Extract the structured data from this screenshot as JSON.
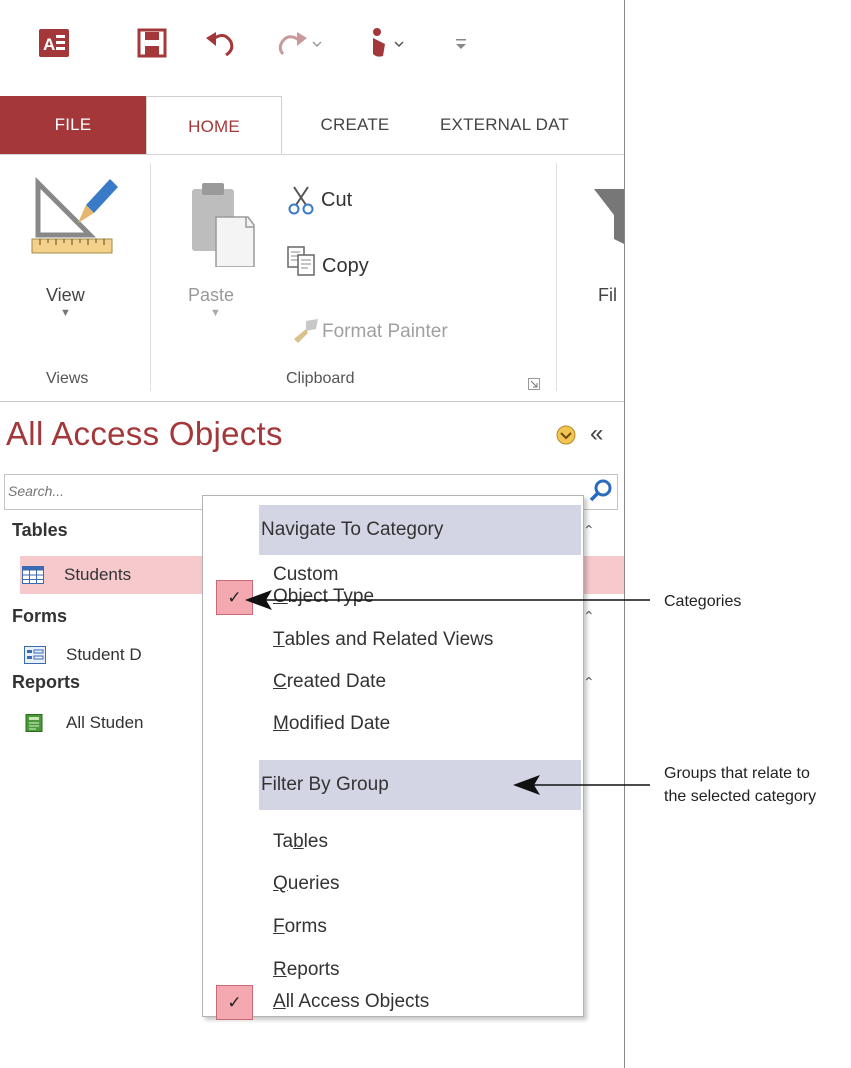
{
  "tabs": {
    "file": "FILE",
    "home": "HOME",
    "create": "CREATE",
    "external": "EXTERNAL DAT"
  },
  "ribbon": {
    "view_label": "View",
    "paste_label": "Paste",
    "cut_label": "Cut",
    "copy_label": "Copy",
    "format_painter_label": "Format Painter",
    "filter_label": "Fil",
    "views_group": "Views",
    "clipboard_group": "Clipboard"
  },
  "nav": {
    "title": "All Access Objects",
    "collapse_glyph": "«",
    "search_placeholder": "Search...",
    "groups": {
      "tables": "Tables",
      "forms": "Forms",
      "reports": "Reports"
    },
    "items": {
      "students": "Students",
      "student_form": "Student D",
      "all_students": "All Studen"
    }
  },
  "menu": {
    "navigate_header": "Navigate To Category",
    "filter_header": "Filter By Group",
    "categories": [
      {
        "label": "Custom",
        "key": ""
      },
      {
        "label": "Object Type",
        "key": "O",
        "rest": "bject Type"
      },
      {
        "label": "Tables and Related Views",
        "key": "T",
        "rest": "ables and Related Views"
      },
      {
        "label": "Created Date",
        "key": "C",
        "rest": "reated Date"
      },
      {
        "label": "Modified Date",
        "key": "M",
        "rest": "odified Date"
      }
    ],
    "groups": [
      {
        "label": "Tables",
        "pre": "Ta",
        "key": "b",
        "rest": "les"
      },
      {
        "label": "Queries",
        "pre": "",
        "key": "Q",
        "rest": "ueries"
      },
      {
        "label": "Forms",
        "pre": "",
        "key": "F",
        "rest": "orms"
      },
      {
        "label": "Reports",
        "pre": "",
        "key": "R",
        "rest": "eports"
      },
      {
        "label": "All Access Objects",
        "pre": "",
        "key": "A",
        "rest": "ll Access Objects"
      }
    ],
    "check_glyph": "✓"
  },
  "callouts": {
    "categories": "Categories",
    "groups_line1": "Groups that relate to",
    "groups_line2": "the selected category"
  },
  "colors": {
    "accent": "#a4373a",
    "selected": "#f6c9cd",
    "menu_header": "#d3d5e4"
  }
}
